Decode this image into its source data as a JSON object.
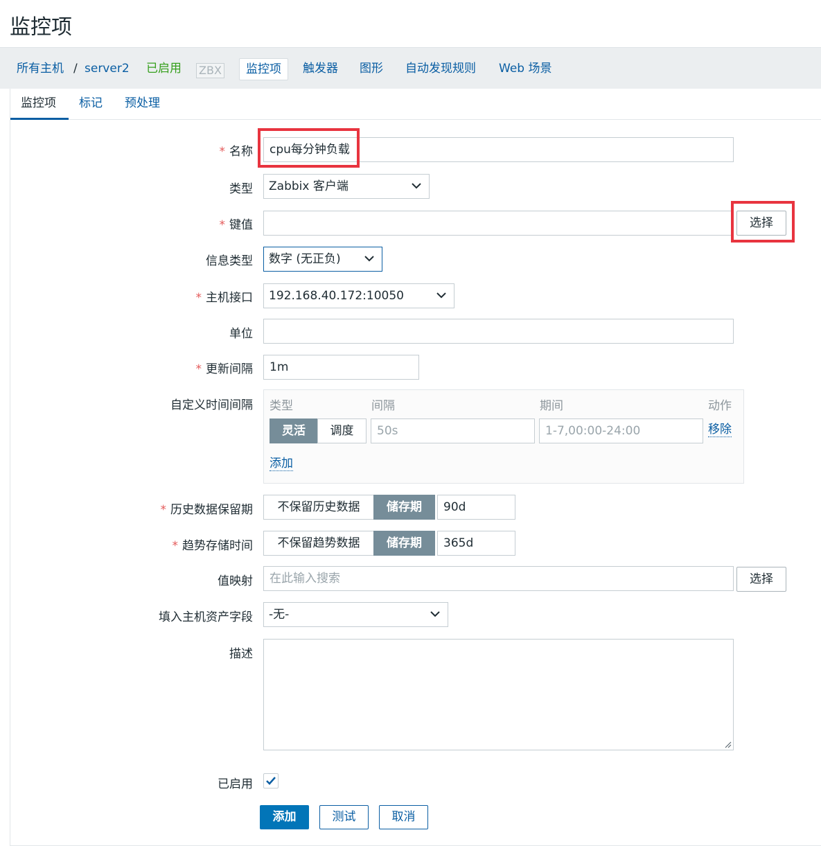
{
  "page": {
    "title": "监控项"
  },
  "hostnav": {
    "all_hosts": "所有主机",
    "separator": "/",
    "host": "server2",
    "status": "已启用",
    "zbx": "ZBX",
    "items": "监控项",
    "triggers": "触发器",
    "graphs": "图形",
    "discovery": "自动发现规则",
    "web": "Web 场景"
  },
  "tabs": [
    "监控项",
    "标记",
    "预处理"
  ],
  "form": {
    "name": {
      "label": "名称",
      "value": "cpu每分钟负载"
    },
    "type": {
      "label": "类型",
      "value": "Zabbix 客户端"
    },
    "key": {
      "label": "键值",
      "value": "",
      "button": "选择"
    },
    "info_type": {
      "label": "信息类型",
      "value": "数字 (无正负)"
    },
    "interface": {
      "label": "主机接口",
      "value": "192.168.40.172:10050"
    },
    "units": {
      "label": "单位",
      "value": ""
    },
    "update_interval": {
      "label": "更新间隔",
      "value": "1m"
    },
    "custom_intervals": {
      "label": "自定义时间间隔",
      "headers": {
        "type": "类型",
        "interval": "间隔",
        "period": "期间",
        "action": "动作"
      },
      "mode_flexible": "灵活",
      "mode_scheduling": "调度",
      "interval_placeholder": "50s",
      "period_placeholder": "1-7,00:00-24:00",
      "remove": "移除",
      "add": "添加"
    },
    "history": {
      "label": "历史数据保留期",
      "off": "不保留历史数据",
      "on": "储存期",
      "value": "90d"
    },
    "trends": {
      "label": "趋势存储时间",
      "off": "不保留趋势数据",
      "on": "储存期",
      "value": "365d"
    },
    "valuemap": {
      "label": "值映射",
      "placeholder": "在此输入搜索",
      "button": "选择"
    },
    "inventory": {
      "label": "填入主机资产字段",
      "value": "-无-"
    },
    "description": {
      "label": "描述",
      "value": ""
    },
    "enabled": {
      "label": "已启用",
      "checked": true
    },
    "required_mark": "*"
  },
  "buttons": {
    "add": "添加",
    "test": "测试",
    "cancel": "取消"
  },
  "colors": {
    "link": "#0a5ea3",
    "highlight": "#e8343f",
    "primary": "#0275b8",
    "toggle_on": "#768d99"
  }
}
